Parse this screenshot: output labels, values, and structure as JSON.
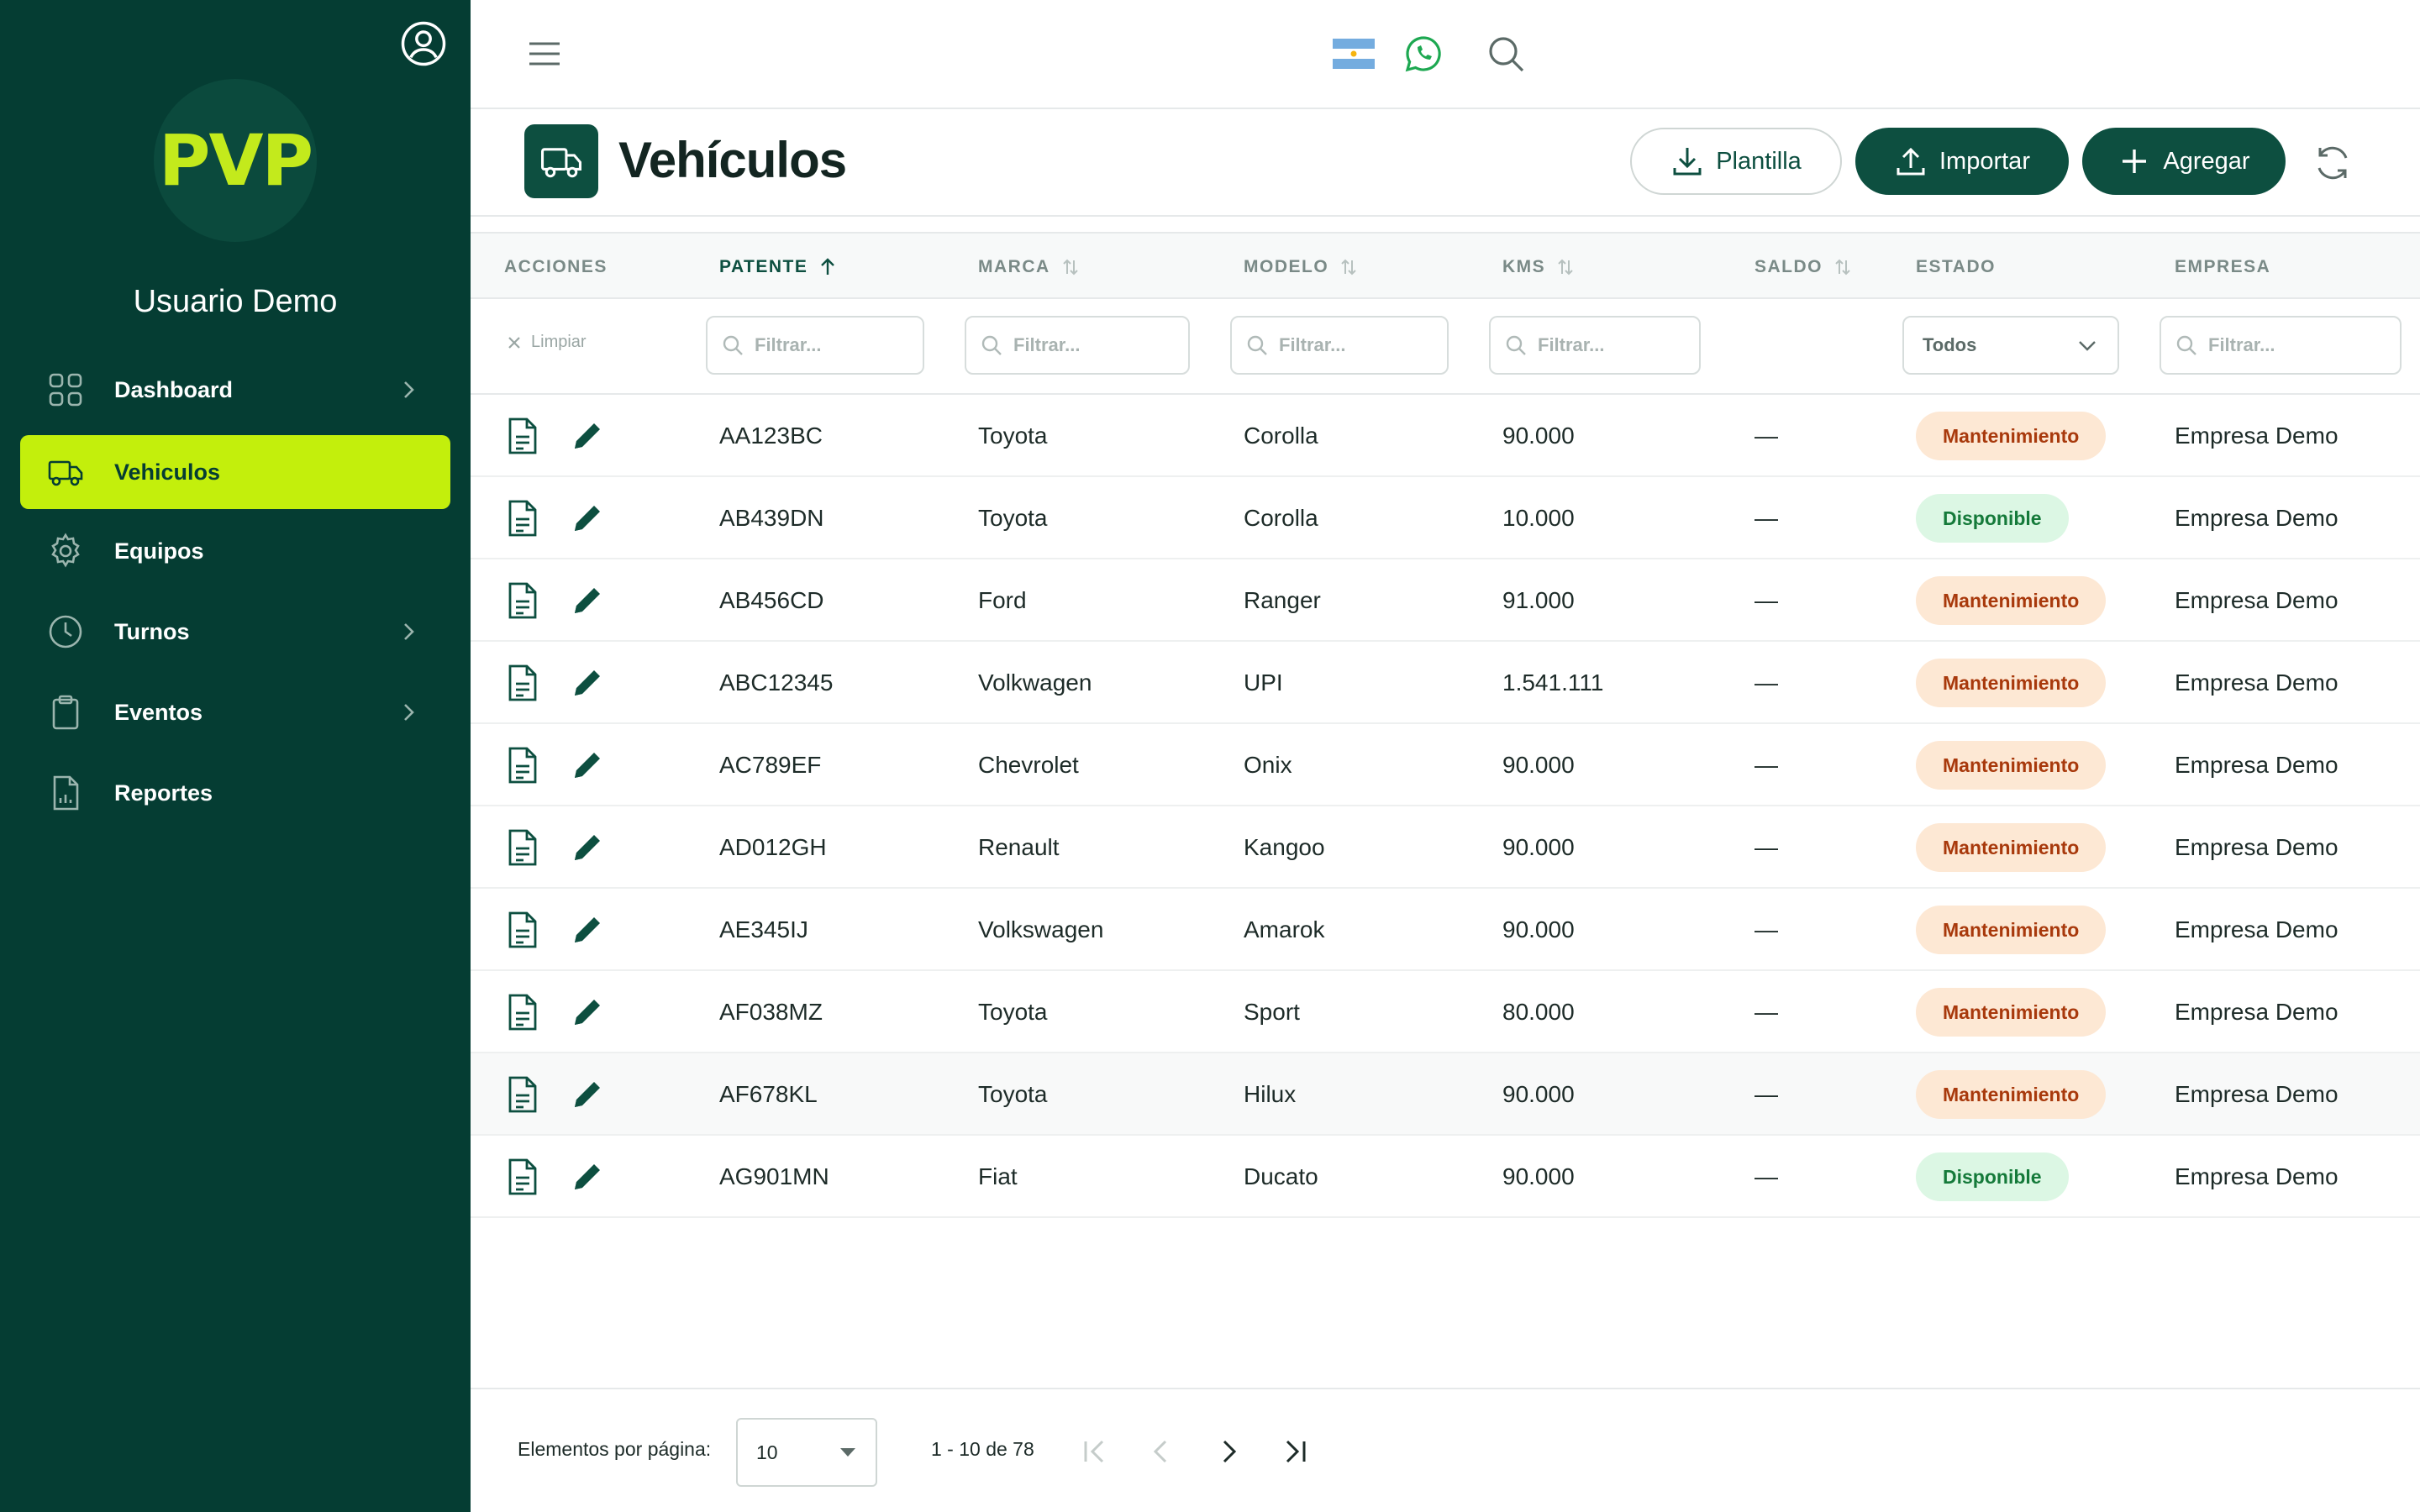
{
  "sidebar": {
    "user_name": "Usuario Demo",
    "logo_text": "PVP",
    "items": [
      {
        "label": "Dashboard",
        "icon": "grid-icon",
        "has_chevron": true,
        "active": false
      },
      {
        "label": "Vehiculos",
        "icon": "truck-icon",
        "has_chevron": false,
        "active": true
      },
      {
        "label": "Equipos",
        "icon": "gear-icon",
        "has_chevron": false,
        "active": false
      },
      {
        "label": "Turnos",
        "icon": "clock-icon",
        "has_chevron": true,
        "active": false
      },
      {
        "label": "Eventos",
        "icon": "clipboard-icon",
        "has_chevron": true,
        "active": false
      },
      {
        "label": "Reportes",
        "icon": "report-icon",
        "has_chevron": false,
        "active": false
      }
    ]
  },
  "page": {
    "title": "Vehículos",
    "buttons": {
      "plantilla": "Plantilla",
      "importar": "Importar",
      "agregar": "Agregar"
    }
  },
  "table": {
    "columns": {
      "acciones": "ACCIONES",
      "patente": "PATENTE",
      "marca": "MARCA",
      "modelo": "MODELO",
      "kms": "KMS",
      "saldo": "SALDO",
      "estado": "ESTADO",
      "empresa": "EMPRESA"
    },
    "filters": {
      "clear_label": "Limpiar",
      "placeholder": "Filtrar...",
      "estado_value": "Todos"
    },
    "rows": [
      {
        "patente": "AA123BC",
        "marca": "Toyota",
        "modelo": "Corolla",
        "kms": "90.000",
        "saldo": "—",
        "estado": "Mantenimiento",
        "empresa": "Empresa Demo"
      },
      {
        "patente": "AB439DN",
        "marca": "Toyota",
        "modelo": "Corolla",
        "kms": "10.000",
        "saldo": "—",
        "estado": "Disponible",
        "empresa": "Empresa Demo"
      },
      {
        "patente": "AB456CD",
        "marca": "Ford",
        "modelo": "Ranger",
        "kms": "91.000",
        "saldo": "—",
        "estado": "Mantenimiento",
        "empresa": "Empresa Demo"
      },
      {
        "patente": "ABC12345",
        "marca": "Volkwagen",
        "modelo": "UPI",
        "kms": "1.541.111",
        "saldo": "—",
        "estado": "Mantenimiento",
        "empresa": "Empresa Demo"
      },
      {
        "patente": "AC789EF",
        "marca": "Chevrolet",
        "modelo": "Onix",
        "kms": "90.000",
        "saldo": "—",
        "estado": "Mantenimiento",
        "empresa": "Empresa Demo"
      },
      {
        "patente": "AD012GH",
        "marca": "Renault",
        "modelo": "Kangoo",
        "kms": "90.000",
        "saldo": "—",
        "estado": "Mantenimiento",
        "empresa": "Empresa Demo"
      },
      {
        "patente": "AE345IJ",
        "marca": "Volkswagen",
        "modelo": "Amarok",
        "kms": "90.000",
        "saldo": "—",
        "estado": "Mantenimiento",
        "empresa": "Empresa Demo"
      },
      {
        "patente": "AF038MZ",
        "marca": "Toyota",
        "modelo": "Sport",
        "kms": "80.000",
        "saldo": "—",
        "estado": "Mantenimiento",
        "empresa": "Empresa Demo"
      },
      {
        "patente": "AF678KL",
        "marca": "Toyota",
        "modelo": "Hilux",
        "kms": "90.000",
        "saldo": "—",
        "estado": "Mantenimiento",
        "empresa": "Empresa Demo"
      },
      {
        "patente": "AG901MN",
        "marca": "Fiat",
        "modelo": "Ducato",
        "kms": "90.000",
        "saldo": "—",
        "estado": "Disponible",
        "empresa": "Empresa Demo"
      }
    ]
  },
  "paginator": {
    "label": "Elementos por página:",
    "page_size": "10",
    "range": "1 - 10 de 78"
  },
  "colors": {
    "sidebar_bg": "#053d33",
    "accent_lime": "#c3ef0c",
    "primary": "#0d4f40",
    "warn_bg": "#fde8d4",
    "warn_text": "#a8390c",
    "ok_bg": "#dcf7e4",
    "ok_text": "#157a3a"
  }
}
